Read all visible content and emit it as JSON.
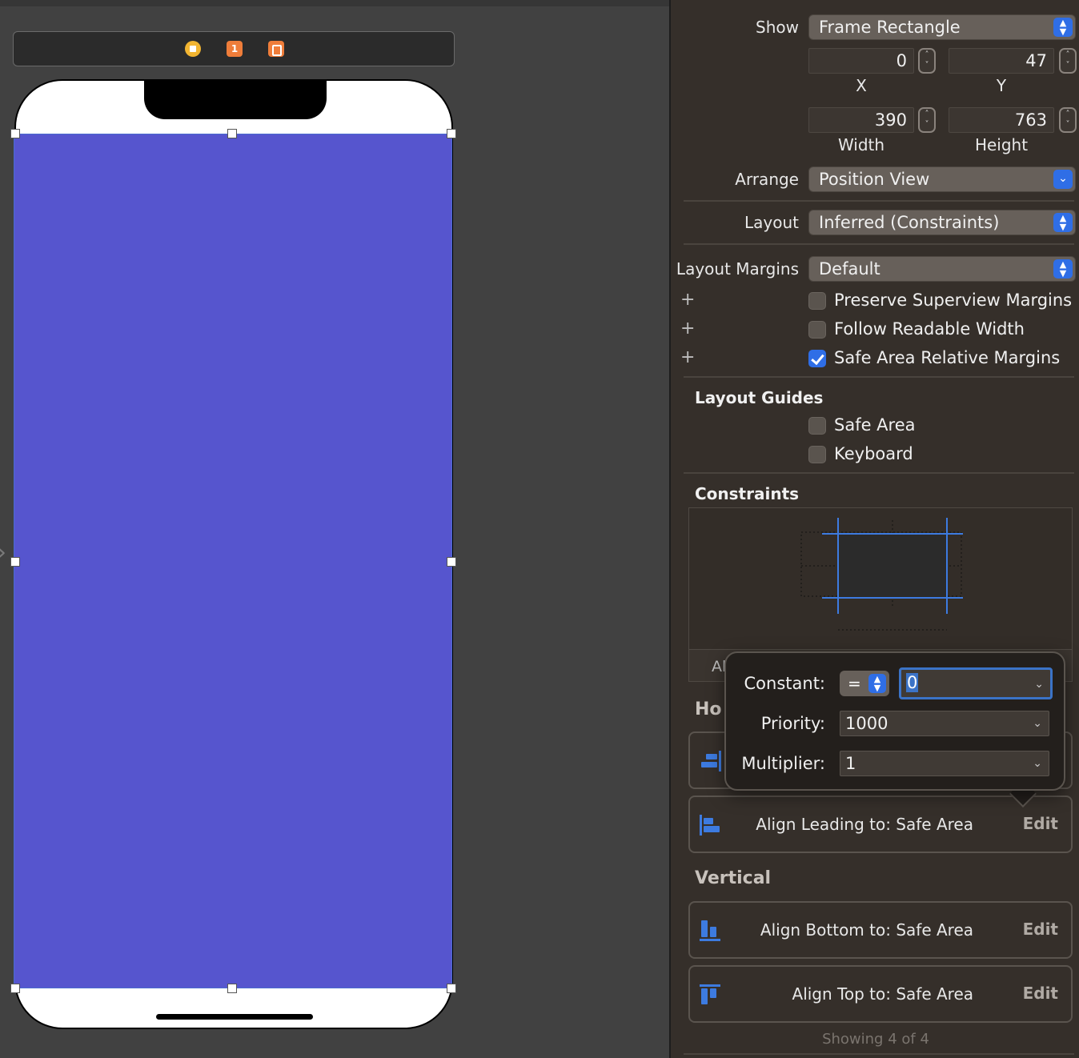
{
  "canvas": {
    "dock": {
      "first_responder_badge": "1"
    }
  },
  "inspector": {
    "show": {
      "label": "Show",
      "value": "Frame Rectangle"
    },
    "frame": {
      "x": {
        "value": "0",
        "caption": "X"
      },
      "y": {
        "value": "47",
        "caption": "Y"
      },
      "width": {
        "value": "390",
        "caption": "Width"
      },
      "height": {
        "value": "763",
        "caption": "Height"
      }
    },
    "arrange": {
      "label": "Arrange",
      "value": "Position View"
    },
    "layout": {
      "label": "Layout",
      "value": "Inferred (Constraints)"
    },
    "layout_margins": {
      "label": "Layout Margins",
      "value": "Default"
    },
    "margin_options": [
      {
        "label": "Preserve Superview Margins",
        "checked": false
      },
      {
        "label": "Follow Readable Width",
        "checked": false
      },
      {
        "label": "Safe Area Relative Margins",
        "checked": true
      }
    ],
    "layout_guides": {
      "title": "Layout Guides",
      "options": [
        {
          "label": "Safe Area",
          "checked": false
        },
        {
          "label": "Keyboard",
          "checked": false
        }
      ]
    },
    "constraints": {
      "title": "Constraints",
      "footer_partial": "Al",
      "horizontal_partial": "Ho",
      "vertical_title": "Vertical",
      "rows": [
        {
          "text": "Align Leading to:  Safe Area",
          "edit": "Edit",
          "icon": "align-leading-icon"
        },
        {
          "text": "Align Bottom to:  Safe Area",
          "edit": "Edit",
          "icon": "align-bottom-icon"
        },
        {
          "text": "Align Top to:  Safe Area",
          "edit": "Edit",
          "icon": "align-top-icon"
        }
      ],
      "showing": "Showing 4 of 4"
    }
  },
  "popover": {
    "constant_label": "Constant:",
    "relation": "=",
    "constant_value": "0",
    "priority_label": "Priority:",
    "priority_value": "1000",
    "multiplier_label": "Multiplier:",
    "multiplier_value": "1"
  },
  "colors": {
    "view_background": "#5655ce",
    "accent": "#2f6ee6",
    "inspector_bg": "#352f2a",
    "canvas_bg": "#414141"
  }
}
